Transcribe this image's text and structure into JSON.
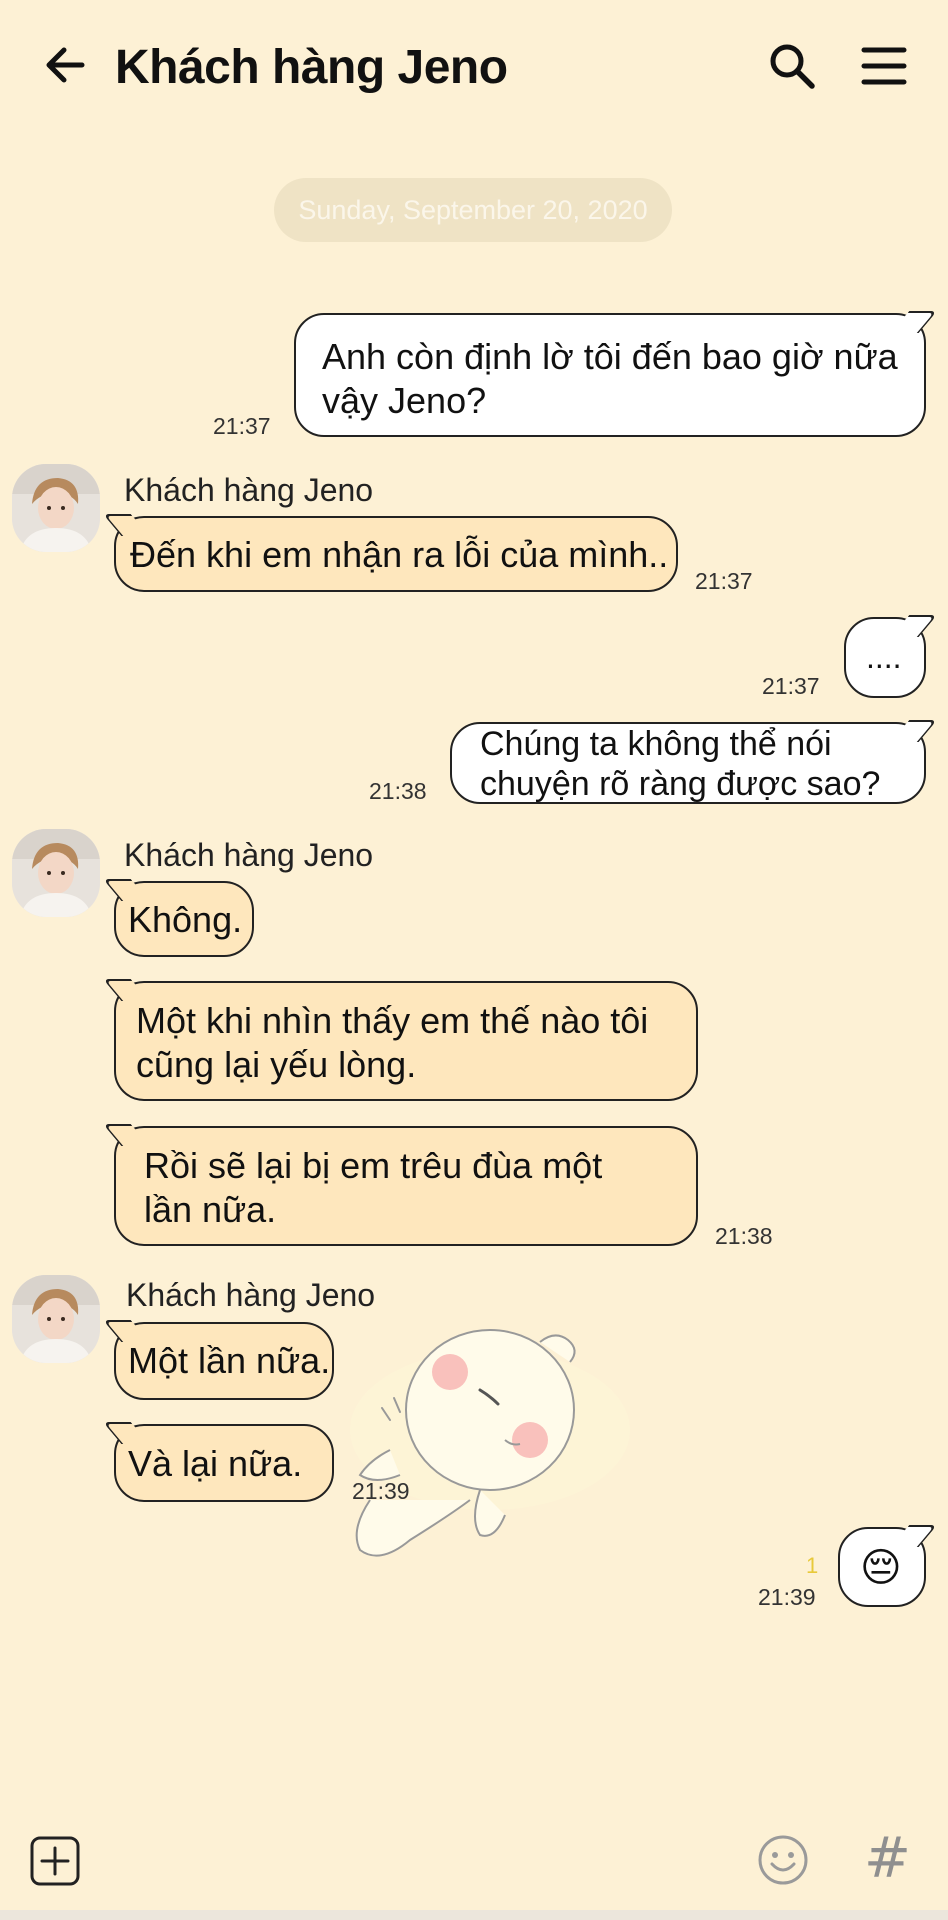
{
  "header": {
    "title": "Khách hàng Jeno",
    "back_icon": "arrow-left-icon",
    "search_icon": "search-icon",
    "menu_icon": "menu-icon"
  },
  "date_divider": "Sunday, September 20, 2020",
  "messages": [
    {
      "from": "me",
      "lines": [
        "Anh còn định lờ tôi đến bao giờ nữa",
        "vậy Jeno?"
      ],
      "time": "21:37"
    },
    {
      "from": "them",
      "sender": "Khách hàng Jeno",
      "lines": [
        "Đến khi em nhận ra lỗi của mình.."
      ],
      "time": "21:37"
    },
    {
      "from": "me",
      "lines": [
        "...."
      ],
      "time": "21:37"
    },
    {
      "from": "me",
      "lines": [
        "Chúng ta không thể nói",
        "chuyện rõ ràng được sao?"
      ],
      "time": "21:38"
    },
    {
      "from": "them",
      "sender": "Khách hàng Jeno",
      "lines": [
        "Không."
      ]
    },
    {
      "from": "them",
      "lines": [
        "Một khi nhìn thấy em thế nào tôi",
        "cũng lại yếu lòng."
      ]
    },
    {
      "from": "them",
      "lines": [
        "Rồi sẽ lại bị em trêu đùa một",
        "lần nữa."
      ],
      "time": "21:38"
    },
    {
      "from": "them",
      "sender": "Khách hàng Jeno",
      "lines": [
        "Một lần nữa."
      ]
    },
    {
      "from": "them",
      "lines": [
        "Và lại nữa."
      ],
      "time": "21:39",
      "sticker": "sleeping-bun-sticker"
    },
    {
      "from": "me",
      "emoji": "😔",
      "unread_count": "1",
      "time": "21:39"
    }
  ],
  "bottom_bar": {
    "plus_icon": "add-icon",
    "emoji_icon": "emoji-icon",
    "hash_label": "#"
  },
  "colors": {
    "background": "#fdf1d5",
    "their_bubble": "#fee7bd",
    "my_bubble": "#ffffff",
    "unread": "#e8c93a"
  }
}
